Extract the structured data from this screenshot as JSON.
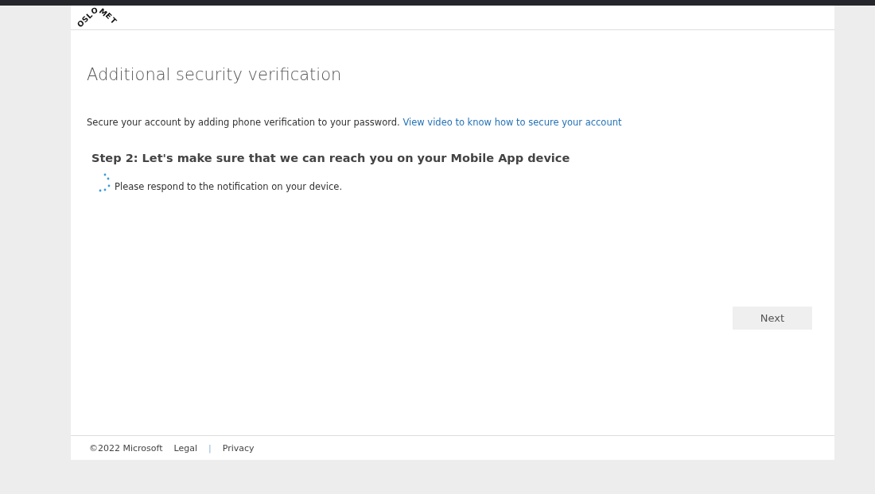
{
  "logo": {
    "text": "OSLOMET"
  },
  "title": "Additional security verification",
  "intro": {
    "text": "Secure your account by adding phone verification to your password.",
    "link": "View video to know how to secure your account"
  },
  "step": {
    "heading": "Step 2: Let's make sure that we can reach you on your Mobile App device",
    "status": "Please respond to the notification on your device."
  },
  "buttons": [
    {
      "label": "Next",
      "disabled": true
    }
  ],
  "footer": {
    "copyright": "©2022 Microsoft",
    "links": [
      "Legal",
      "Privacy"
    ],
    "separator": "|"
  }
}
